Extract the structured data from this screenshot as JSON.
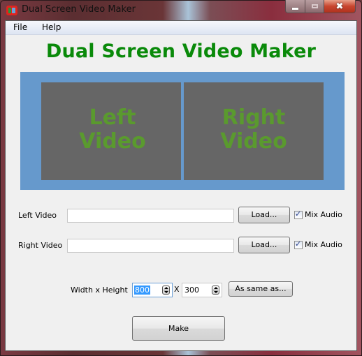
{
  "window": {
    "title": "Dual Screen Video Maker",
    "icon": "app-icon",
    "controls": {
      "minimize": "minimize-icon",
      "maximize": "maximize-icon",
      "close_glyph": "✖"
    }
  },
  "menubar": {
    "items": [
      {
        "label": "File"
      },
      {
        "label": "Help"
      }
    ]
  },
  "heading": "Dual Screen Video Maker",
  "preview": {
    "left_label_line1": "Left",
    "left_label_line2": "Video",
    "right_label_line1": "Right",
    "right_label_line2": "Video",
    "colors": {
      "background": "#6699cc",
      "pane": "#666666",
      "label": "#5a9a2e"
    }
  },
  "left_video": {
    "label": "Left Video",
    "path_value": "",
    "load_label": "Load...",
    "mix_audio_label": "Mix Audio",
    "mix_audio_checked": true
  },
  "right_video": {
    "label": "Right Video",
    "path_value": "",
    "load_label": "Load...",
    "mix_audio_label": "Mix Audio",
    "mix_audio_checked": true
  },
  "size": {
    "label": "Width x Height",
    "width": "800",
    "separator": "X",
    "height": "300",
    "same_as_label": "As same as..."
  },
  "make_label": "Make",
  "check_glyph": "✓"
}
